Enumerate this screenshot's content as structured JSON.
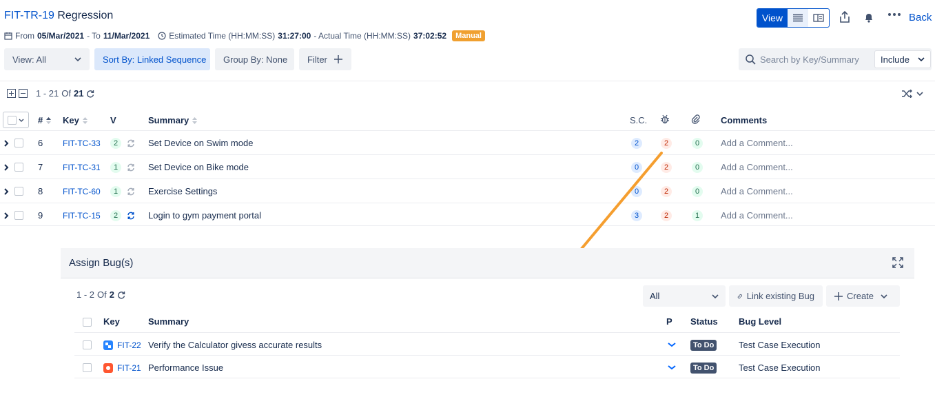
{
  "header": {
    "key": "FIT-TR-19",
    "name": "Regression",
    "from_label": "From",
    "from_date": "05/Mar/2021",
    "to_label": "- To",
    "to_date": "11/Mar/2021",
    "est_label": "Estimated Time (HH:MM:SS)",
    "est_value": "31:27:00",
    "act_label": "- Actual Time (HH:MM:SS)",
    "act_value": "37:02:52",
    "badge": "Manual",
    "view_label": "View",
    "back_label": "Back"
  },
  "toolbar": {
    "view": "View: All",
    "sort": "Sort By: Linked Sequence",
    "group": "Group By: None",
    "filter": "Filter",
    "search_placeholder": "Search by Key/Summary",
    "include": "Include"
  },
  "pagination": {
    "range": "1 - 21",
    "of": "Of",
    "total": "21"
  },
  "table": {
    "columns": {
      "num": "#",
      "key": "Key",
      "v": "V",
      "summary": "Summary",
      "sc": "S.C.",
      "comments": "Comments"
    },
    "rows": [
      {
        "num": "6",
        "key": "FIT-TC-33",
        "v": "2",
        "summary": "Set Device on Swim mode",
        "sc": "2",
        "bugs": "2",
        "attach": "0",
        "comment": "Add a Comment...",
        "sync": "grey"
      },
      {
        "num": "7",
        "key": "FIT-TC-31",
        "v": "1",
        "summary": "Set Device on Bike mode",
        "sc": "0",
        "bugs": "2",
        "attach": "0",
        "comment": "Add a Comment...",
        "sync": "grey"
      },
      {
        "num": "8",
        "key": "FIT-TC-60",
        "v": "1",
        "summary": "Exercise Settings",
        "sc": "0",
        "bugs": "2",
        "attach": "0",
        "comment": "Add a Comment...",
        "sync": "grey"
      },
      {
        "num": "9",
        "key": "FIT-TC-15",
        "v": "2",
        "summary": "Login to gym payment portal",
        "sc": "3",
        "bugs": "2",
        "attach": "1",
        "comment": "Add a Comment...",
        "sync": "blue"
      }
    ]
  },
  "assign": {
    "title": "Assign Bug(s)",
    "pagination": {
      "range": "1 - 2",
      "of": "Of",
      "total": "2"
    },
    "filter": "All",
    "link_label": "Link existing Bug",
    "create_label": "Create",
    "columns": {
      "key": "Key",
      "summary": "Summary",
      "p": "P",
      "status": "Status",
      "level": "Bug Level"
    },
    "rows": [
      {
        "key": "FIT-22",
        "summary": "Verify the Calculator givess accurate results",
        "status": "To Do",
        "level": "Test Case Execution",
        "type_color": "#2684ff"
      },
      {
        "key": "FIT-21",
        "summary": "Performance Issue",
        "status": "To Do",
        "level": "Test Case Execution",
        "type_color": "#ff5630"
      }
    ]
  },
  "colors": {
    "accent": "#0052cc",
    "manual_badge": "#f0a030",
    "arrow": "#f59e2f"
  }
}
